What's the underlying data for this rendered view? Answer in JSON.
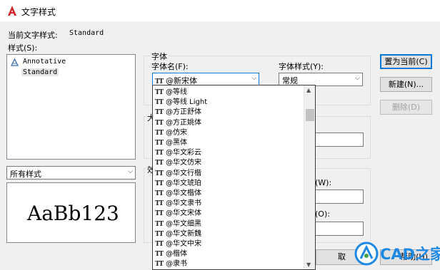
{
  "window": {
    "title": "文字样式"
  },
  "current_style": {
    "label": "当前文字样式:",
    "value": "Standard"
  },
  "styles": {
    "label": "样式(S):",
    "items": [
      "Annotative",
      "Standard"
    ]
  },
  "filter": {
    "value": "所有样式"
  },
  "preview": {
    "text": "AaBb123"
  },
  "font_group": {
    "title": "字体",
    "font_name_label": "字体名(F):",
    "font_name_value": "@新宋体",
    "font_style_label": "字体样式(Y):",
    "font_style_value": "常规"
  },
  "font_list": [
    "@等线",
    "@等线 Light",
    "@方正舒体",
    "@方正姚体",
    "@仿宋",
    "@黑体",
    "@华文彩云",
    "@华文仿宋",
    "@华文行楷",
    "@华文琥珀",
    "@华文楷体",
    "@华文隶书",
    "@华文宋体",
    "@华文细黑",
    "@华文新魏",
    "@华文中宋",
    "@楷体",
    "@隶书"
  ],
  "partial_labels": {
    "size_group": "大",
    "effects_group": "效",
    "width_label": "(W):",
    "angle_label": "(O):"
  },
  "buttons": {
    "set_current": "置为当前(C)",
    "new": "新建(N)...",
    "delete": "删除(D)",
    "cancel": "取",
    "help": "帮助(H)"
  },
  "watermark": {
    "text": "CAD之家"
  },
  "colors": {
    "accent": "#0078d7",
    "app_icon": "#d2232a",
    "watermark": "#1e88e5"
  }
}
